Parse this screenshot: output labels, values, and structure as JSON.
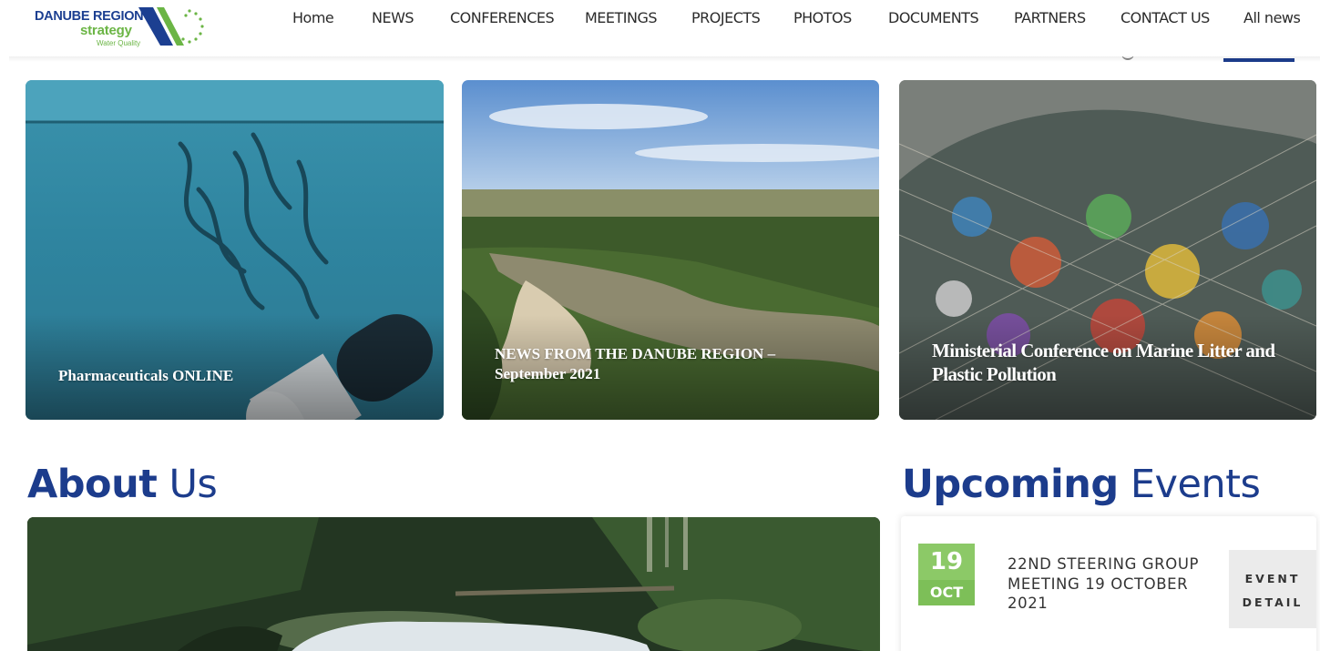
{
  "header": {
    "logo": {
      "title": "DANUBE REGION",
      "strategy": "strategy",
      "subtitle": "Water Quality"
    },
    "nav": [
      {
        "label": "Home"
      },
      {
        "label": "NEWS"
      },
      {
        "label": "CONFERENCES"
      },
      {
        "label": "MEETINGS"
      },
      {
        "label": "PROJECTS"
      },
      {
        "label": "PHOTOS"
      },
      {
        "label": "DOCUMENTS"
      },
      {
        "label": "PARTNERS"
      },
      {
        "label": "CONTACT US"
      },
      {
        "label": "All news"
      }
    ]
  },
  "news_cards": [
    {
      "title": "Pharmaceuticals ONLINE"
    },
    {
      "title": "NEWS FROM THE DANUBE REGION – September 2021"
    },
    {
      "title": "Ministerial Conference on Marine Litter and Plastic Pollution"
    }
  ],
  "about": {
    "heading_bold": "About",
    "heading_rest": " Us"
  },
  "events": {
    "heading_bold": "Upcoming",
    "heading_rest": " Events",
    "items": [
      {
        "day": "19",
        "month": "OCT",
        "title": "22ND STEERING GROUP MEETING 19 OCTOBER 2021",
        "button_line1": "EVENT",
        "button_line2": "DETAIL"
      }
    ]
  },
  "colors": {
    "brand_blue": "#1c3c8c",
    "brand_green": "#6bb545",
    "date_green": "#8cc967"
  },
  "icons": [
    "logo-mark-icon",
    "search-icon"
  ]
}
